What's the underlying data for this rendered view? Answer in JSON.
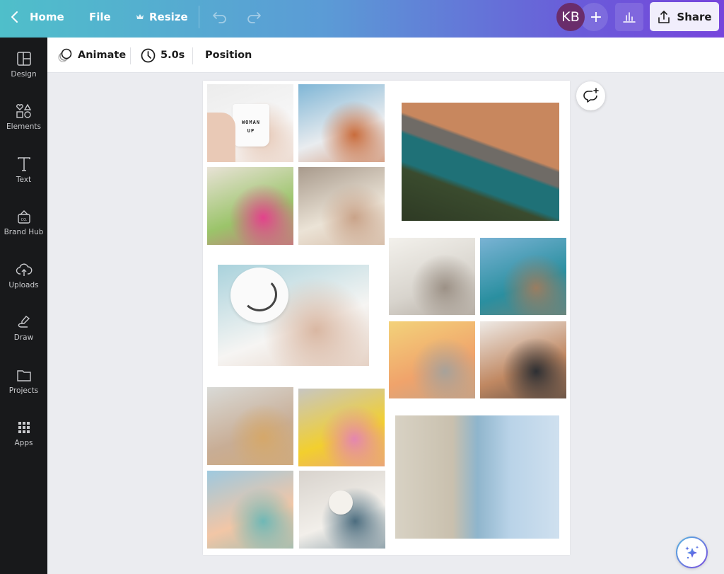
{
  "topbar": {
    "home_label": "Home",
    "file_label": "File",
    "resize_label": "Resize",
    "avatar_initials": "KB",
    "add_label": "+",
    "share_label": "Share"
  },
  "sidebar": {
    "items": [
      {
        "label": "Design",
        "icon": "layout-icon"
      },
      {
        "label": "Elements",
        "icon": "shapes-icon"
      },
      {
        "label": "Text",
        "icon": "text-icon"
      },
      {
        "label": "Brand Hub",
        "icon": "brand-hub-icon"
      },
      {
        "label": "Uploads",
        "icon": "cloud-upload-icon"
      },
      {
        "label": "Draw",
        "icon": "draw-icon"
      },
      {
        "label": "Projects",
        "icon": "folder-icon"
      },
      {
        "label": "Apps",
        "icon": "apps-grid-icon"
      }
    ]
  },
  "toolbar": {
    "animate_label": "Animate",
    "duration_label": "5.0s",
    "position_label": "Position"
  },
  "canvas": {
    "photos": [
      {
        "name": "photo-woman-up-mug",
        "caption_text": "WOMAN UP",
        "colors": [
          "#ececec",
          "#f7f7f7",
          "#e6c7b4"
        ]
      },
      {
        "name": "photo-boat-flag",
        "colors": [
          "#7fb6d6",
          "#e9ecef",
          "#c96c3c"
        ]
      },
      {
        "name": "photo-flower-bouquet",
        "colors": [
          "#e8e2d6",
          "#9bc46a",
          "#e3428c"
        ]
      },
      {
        "name": "photo-sand-dollar-hand",
        "colors": [
          "#a89a8c",
          "#ebe3d6",
          "#c9a389"
        ]
      },
      {
        "name": "photo-sun-drawn-leg",
        "colors": [
          "#c8875e",
          "#1f7177",
          "#3a4b2e"
        ]
      },
      {
        "name": "photo-white-roses",
        "colors": [
          "#f3f1ec",
          "#d8d4cd",
          "#9c9186"
        ]
      },
      {
        "name": "photo-marina-dock",
        "colors": [
          "#7ab3d4",
          "#2a8fa0",
          "#9a7d61"
        ]
      },
      {
        "name": "photo-hat-pool",
        "colors": [
          "#a9d2dc",
          "#f6f5f3",
          "#d9b7a2"
        ]
      },
      {
        "name": "photo-yellow-dahlias",
        "colors": [
          "#f3d27a",
          "#f0a36b",
          "#a7a29a"
        ]
      },
      {
        "name": "photo-legs-window",
        "colors": [
          "#eeeae6",
          "#c08862",
          "#2d2f33"
        ]
      },
      {
        "name": "photo-glass-coffee-cup",
        "colors": [
          "#d9dad7",
          "#c8ad95",
          "#d5a86a"
        ]
      },
      {
        "name": "photo-colorful-bouquet",
        "colors": [
          "#c7c6c2",
          "#f2cf2e",
          "#e486b0"
        ]
      },
      {
        "name": "photo-sailboat",
        "colors": [
          "#9ec9df",
          "#f2c6a6",
          "#6fb8b6"
        ]
      },
      {
        "name": "photo-sand-dollar-fingers",
        "colors": [
          "#d8d3cd",
          "#f2efea",
          "#4c6d7f"
        ]
      },
      {
        "name": "photo-dock-flowers",
        "colors": [
          "#b9d3e8",
          "#d8d2c4",
          "#e4498c"
        ]
      }
    ]
  }
}
